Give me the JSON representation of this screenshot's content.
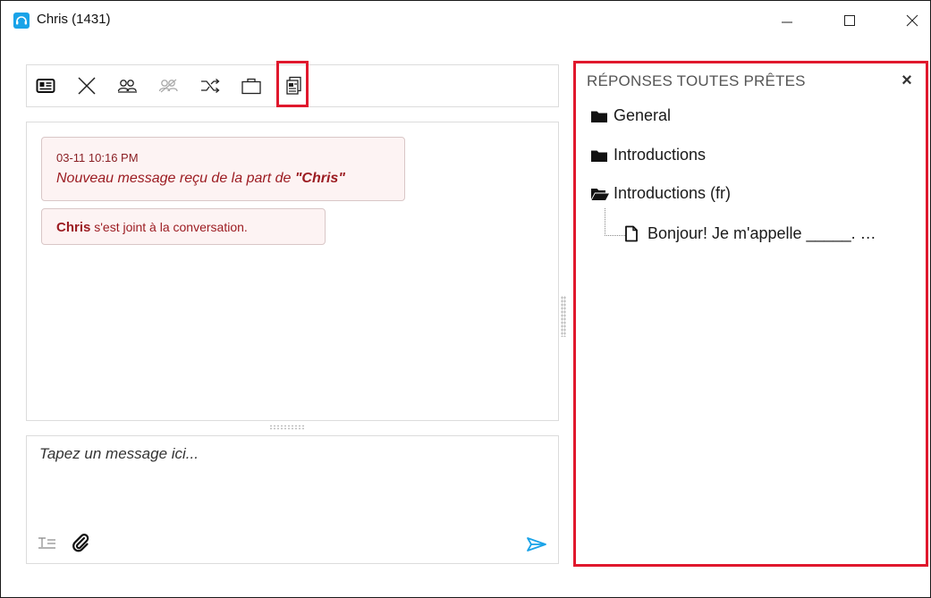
{
  "window": {
    "title": "Chris (1431)",
    "minimize_label": "—",
    "maximize_label": "☐",
    "close_label": "✕"
  },
  "toolbar": {
    "buttons": [
      {
        "icon": "contact-card-icon"
      },
      {
        "icon": "close-x-icon"
      },
      {
        "icon": "users-icon"
      },
      {
        "icon": "users-disabled-icon"
      },
      {
        "icon": "transfer-icon"
      },
      {
        "icon": "briefcase-icon"
      },
      {
        "icon": "canned-responses-icon"
      }
    ]
  },
  "chat": {
    "messages": [
      {
        "timestamp": "03-11 10:16 PM",
        "text_prefix": "Nouveau message reçu de la part de ",
        "sender_quoted": "\"Chris\""
      },
      {
        "name": "Chris",
        "text": " s'est joint à la conversation."
      }
    ]
  },
  "composer": {
    "placeholder": "Tapez un message ici..."
  },
  "canned": {
    "title": "RÉPONSES TOUTES PRÊTES",
    "close_label": "×",
    "items": [
      {
        "label": "General",
        "icon": "folder-icon"
      },
      {
        "label": "Introductions",
        "icon": "folder-icon"
      },
      {
        "label": "Introductions (fr)",
        "icon": "folder-open-icon"
      },
      {
        "label": "Bonjour! Je m'appelle _____. …",
        "icon": "document-icon"
      }
    ]
  },
  "colors": {
    "highlight": "#e0182d",
    "message_text": "#9c1c22",
    "accent": "#1aa3e8"
  }
}
